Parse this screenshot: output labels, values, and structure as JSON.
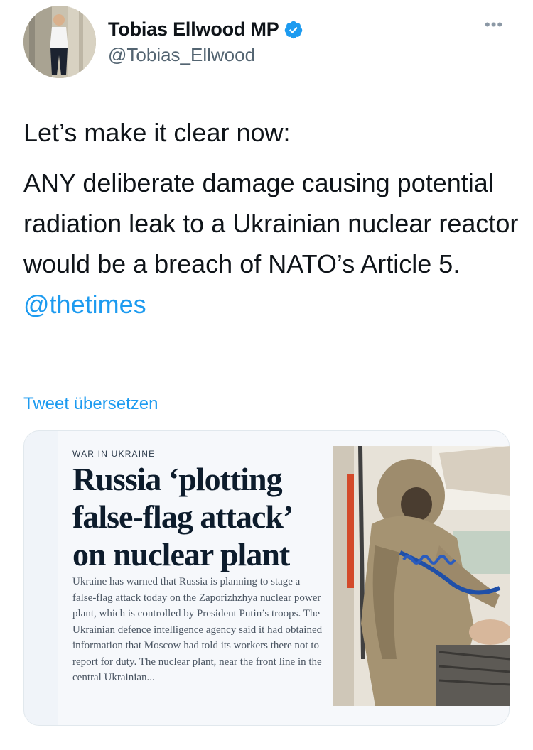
{
  "user": {
    "name": "Tobias Ellwood MP",
    "handle": "@Tobias_Ellwood",
    "avatar_icon": "profile-photo",
    "verified_icon": "verified-badge-icon",
    "more_icon": "more-options-icon",
    "more_glyph": "•••"
  },
  "tweet": {
    "line1": "Let’s make it clear now:",
    "line2": "ANY deliberate damage causing potential radiation leak to a Ukrainian nuclear reactor would be a breach of NATO’s Article 5.",
    "mention": "@thetimes",
    "translate_label": "Tweet übersetzen"
  },
  "card": {
    "kicker": "WAR IN UKRAINE",
    "headline": "Russia ‘plotting false-flag attack’ on nuclear plant",
    "summary": "Ukraine has warned that Russia is planning to stage a false-flag attack today on the Zaporizhzhya nuclear power plant, which is controlled by President Putin’s troops. The Ukrainian defence intelligence agency said it had obtained information that Moscow had told its workers there not to report for duty. The nuclear plant, near the front line in the central Ukrainian...",
    "image": "hazmat-suit-photo"
  },
  "colors": {
    "accent": "#1d9bf0",
    "text": "#0f1419",
    "secondary": "#536471",
    "card_bg": "#f0f4f9"
  }
}
